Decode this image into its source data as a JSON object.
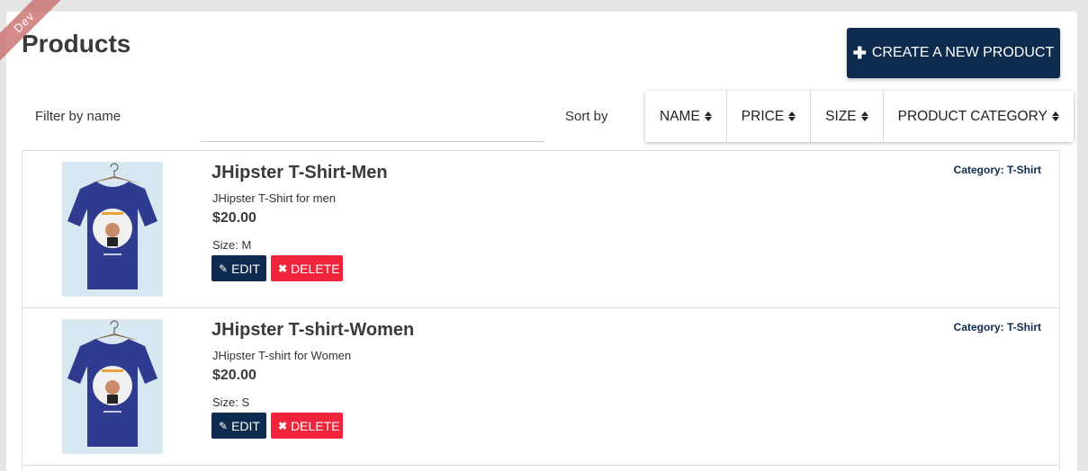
{
  "ribbon": {
    "label": "Dev"
  },
  "page": {
    "title": "Products"
  },
  "toolbar": {
    "create_label": "CREATE A NEW PRODUCT",
    "create_icon": "plus-icon"
  },
  "filter": {
    "label": "Filter by name",
    "value": "",
    "placeholder": ""
  },
  "sort": {
    "label": "Sort by",
    "options": [
      "NAME",
      "PRICE",
      "SIZE",
      "PRODUCT CATEGORY"
    ]
  },
  "products": [
    {
      "name": "JHipster T-Shirt-Men",
      "description": "JHipster T-Shirt for men",
      "price": "$20.00",
      "size": "Size: M",
      "category": "Category: T-Shirt",
      "edit_label": "EDIT",
      "delete_label": "DELETE"
    },
    {
      "name": "JHipster T-shirt-Women",
      "description": "JHipster T-shirt for Women",
      "price": "$20.00",
      "size": "Size: S",
      "category": "Category: T-Shirt",
      "edit_label": "EDIT",
      "delete_label": "DELETE"
    }
  ],
  "colors": {
    "primary": "#0d2b4e",
    "danger": "#f0243b",
    "shirt": "#2e3b8f",
    "thumb_bg": "#d8e8f3"
  }
}
